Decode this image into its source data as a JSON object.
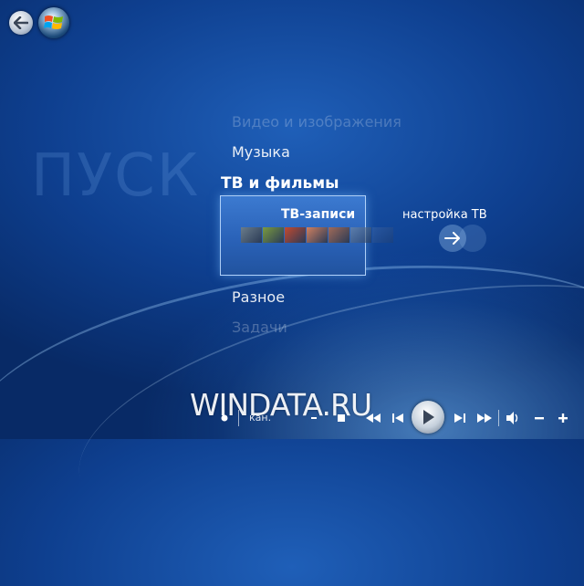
{
  "start_menu": {
    "heading": "ПУСК",
    "items": [
      {
        "label": "Видео и изображения"
      },
      {
        "label": "Музыка"
      },
      {
        "label": "ТВ и фильмы"
      },
      {
        "label": "Разное"
      },
      {
        "label": "Задачи"
      }
    ],
    "selected_tile": {
      "label": "ТВ-записи",
      "thumbnails": [
        "#6a7c8a",
        "#7a9a40",
        "#c24a30",
        "#d08060",
        "#a06a58",
        "#7a8ca0",
        "#5a7ab0"
      ]
    },
    "side_option": {
      "label": "настройка ТВ",
      "icon": "arrow-right-icon"
    }
  },
  "watermark": "WINDATA.RU",
  "transport": {
    "channel_label": "кан."
  },
  "colors": {
    "background": "#0e3f8f",
    "tile": "#2a62b8",
    "text": "#ffffff"
  }
}
